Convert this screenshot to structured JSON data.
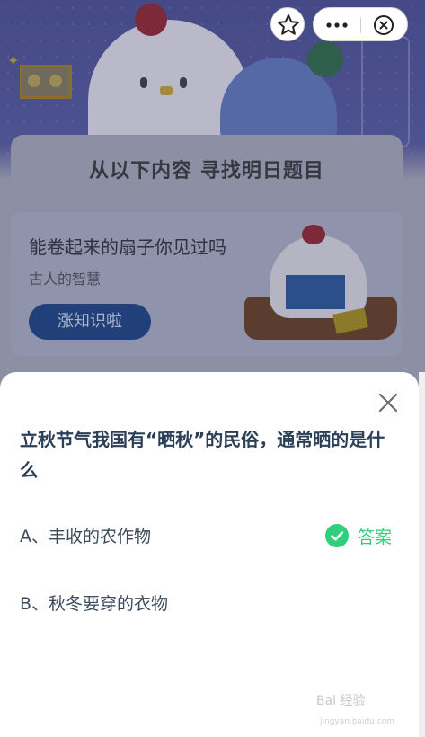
{
  "background": {
    "title": "从以下内容 寻找明日题目",
    "card": {
      "title": "能卷起来的扇子你见过吗",
      "subtitle": "古人的智慧",
      "button_label": "涨知识啦"
    }
  },
  "top_controls": {
    "star_icon": "star-outline-icon",
    "more_icon": "more-dots-icon",
    "close_icon": "close-circle-icon"
  },
  "sheet": {
    "question": "立秋节气我国有“晒秋”的民俗，通常晒的是什么",
    "options": [
      {
        "label": "A、丰收的农作物",
        "is_answer": true
      },
      {
        "label": "B、秋冬要穿的衣物",
        "is_answer": false
      }
    ],
    "answer_label": "答案",
    "answer_color": "#2fcf7b"
  },
  "watermark": {
    "text": "Bai 经验",
    "sub": "jingyan.baidu.com"
  }
}
